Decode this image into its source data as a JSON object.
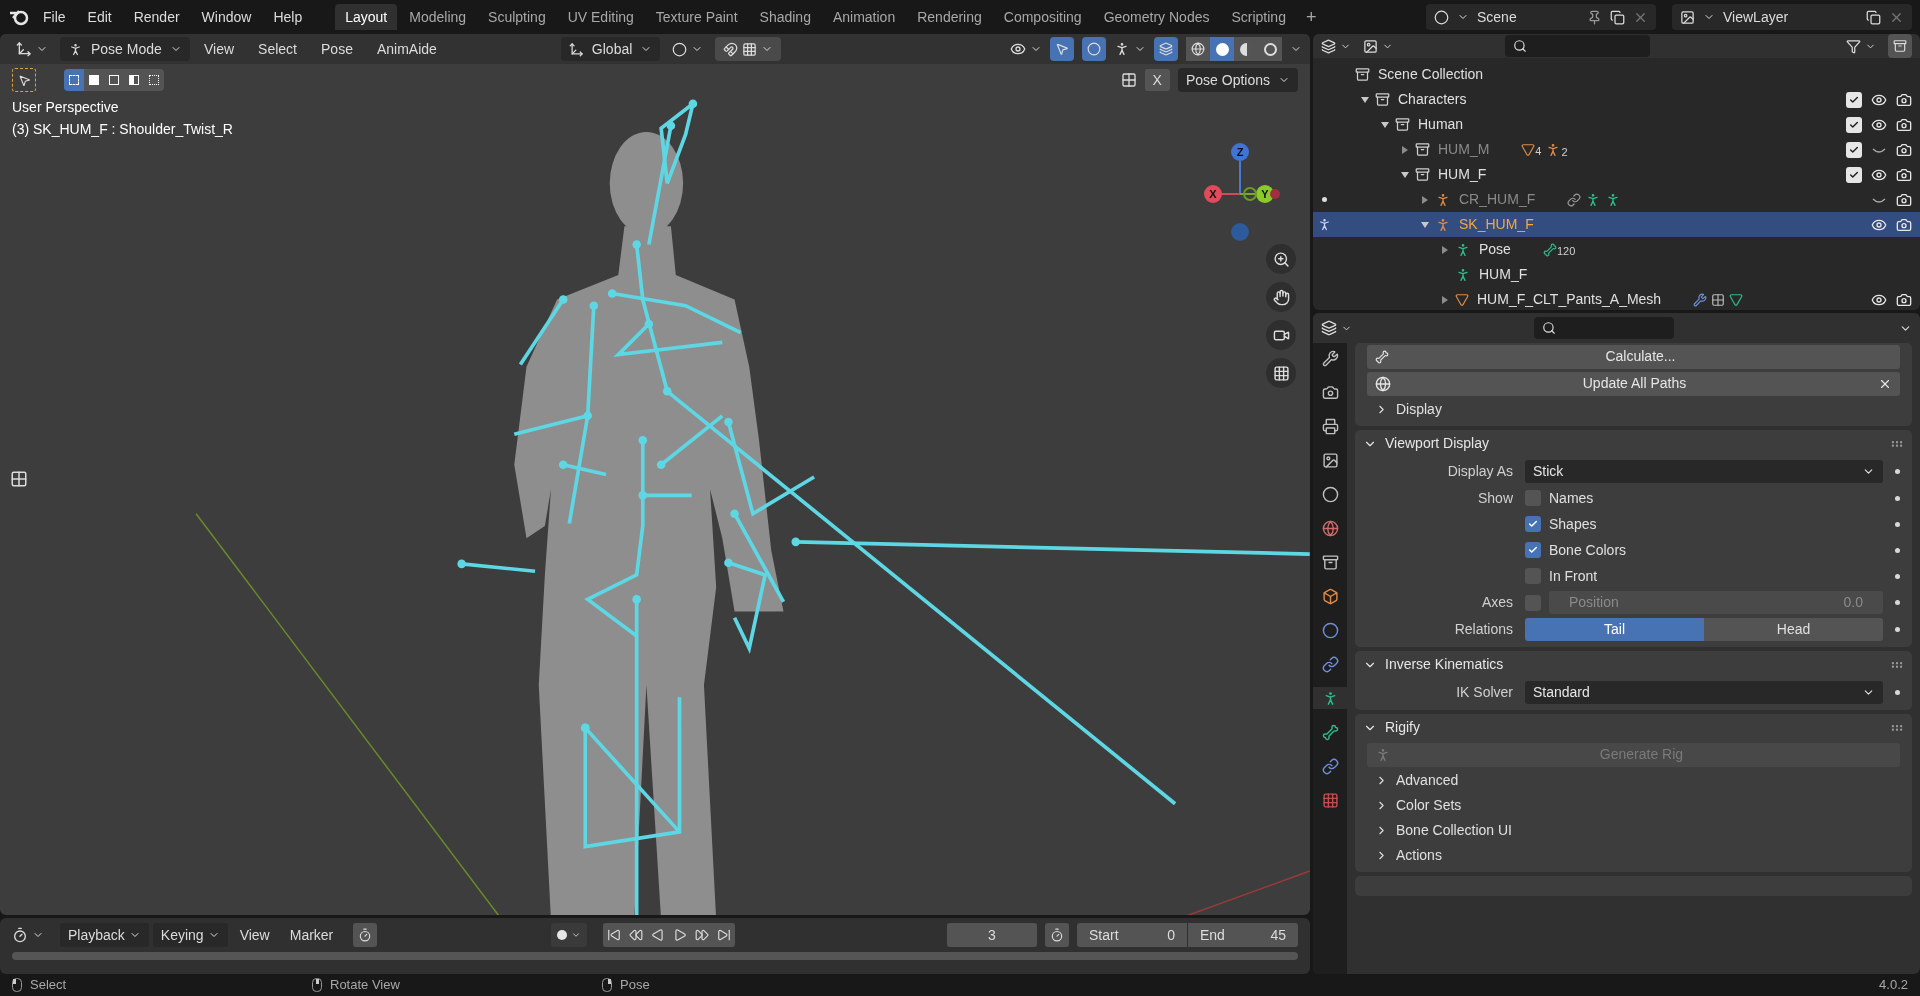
{
  "menu": [
    "File",
    "Edit",
    "Render",
    "Window",
    "Help"
  ],
  "workspaces": [
    {
      "label": "Layout",
      "selected": true
    },
    {
      "label": "Modeling",
      "selected": false
    },
    {
      "label": "Sculpting",
      "selected": false
    },
    {
      "label": "UV Editing",
      "selected": false
    },
    {
      "label": "Texture Paint",
      "selected": false
    },
    {
      "label": "Shading",
      "selected": false
    },
    {
      "label": "Animation",
      "selected": false
    },
    {
      "label": "Rendering",
      "selected": false
    },
    {
      "label": "Compositing",
      "selected": false
    },
    {
      "label": "Geometry Nodes",
      "selected": false
    },
    {
      "label": "Scripting",
      "selected": false
    }
  ],
  "add_workspace": "+",
  "scene": "Scene",
  "view_layer": "ViewLayer",
  "viewport": {
    "mode": "Pose Mode",
    "menus": [
      "View",
      "Select",
      "Pose",
      "AnimAide"
    ],
    "orientation": "Global",
    "shading": [
      {
        "kind": "wireframe",
        "selected": false
      },
      {
        "kind": "solid",
        "selected": true
      },
      {
        "kind": "material",
        "selected": false
      },
      {
        "kind": "rendered",
        "selected": false
      }
    ],
    "select_modes": [
      {
        "kind": "set",
        "selected": true
      },
      {
        "kind": "extend",
        "selected": false
      },
      {
        "kind": "subtract",
        "selected": false
      },
      {
        "kind": "invert",
        "selected": false
      },
      {
        "kind": "intersect",
        "selected": false
      }
    ],
    "mirror": "X",
    "pose_options": "Pose Options",
    "overlay": [
      "User Perspective",
      "(3) SK_HUM_F : Shoulder_Twist_R"
    ],
    "gizmo": {
      "x": "X",
      "y": "Y",
      "z": "Z"
    }
  },
  "outliner": {
    "tree": [
      {
        "name": "Scene Collection",
        "kind": "collection",
        "children": [
          {
            "name": "Characters",
            "kind": "collection",
            "expanded": true,
            "checked": true,
            "visible": true,
            "children": [
              {
                "name": "Human",
                "kind": "collection",
                "expanded": true,
                "checked": true,
                "visible": true,
                "children": [
                  {
                    "name": "HUM_M",
                    "kind": "collection",
                    "expanded": false,
                    "checked": true,
                    "visible": false,
                    "badges": [
                      {
                        "kind": "mesh",
                        "count": "4"
                      },
                      {
                        "kind": "armature",
                        "count": "2"
                      }
                    ]
                  },
                  {
                    "name": "HUM_F",
                    "kind": "collection",
                    "expanded": true,
                    "checked": true,
                    "visible": true,
                    "children": [
                      {
                        "name": "CR_HUM_F",
                        "kind": "armature",
                        "expanded": false,
                        "visible": false,
                        "mode_dot": true,
                        "badges": [
                          {
                            "kind": "constraint"
                          },
                          {
                            "kind": "pose"
                          },
                          {
                            "kind": "armature_data"
                          }
                        ]
                      },
                      {
                        "name": "SK_HUM_F",
                        "kind": "armature",
                        "expanded": true,
                        "visible": true,
                        "selected": true,
                        "pose_mode": true,
                        "children": [
                          {
                            "name": "Pose",
                            "kind": "pose",
                            "expanded": false,
                            "badges": [
                              {
                                "kind": "bone",
                                "count": "120"
                              }
                            ]
                          },
                          {
                            "name": "HUM_F",
                            "kind": "armature_data"
                          },
                          {
                            "name": "HUM_F_CLT_Pants_A_Mesh",
                            "kind": "mesh",
                            "expanded": false,
                            "visible": true,
                            "badges": [
                              {
                                "kind": "modifier"
                              },
                              {
                                "kind": "grid"
                              },
                              {
                                "kind": "vertex_group"
                              }
                            ]
                          }
                        ]
                      }
                    ]
                  }
                ]
              }
            ]
          }
        ]
      }
    ]
  },
  "properties": {
    "tabs": [
      {
        "kind": "tool",
        "selected": false
      },
      {
        "kind": "render",
        "selected": false
      },
      {
        "kind": "output",
        "selected": false
      },
      {
        "kind": "view_layer",
        "selected": false
      },
      {
        "kind": "scene",
        "selected": false
      },
      {
        "kind": "world",
        "selected": false
      },
      {
        "kind": "collection",
        "selected": false
      },
      {
        "kind": "object",
        "selected": false
      },
      {
        "kind": "physics",
        "selected": false
      },
      {
        "kind": "constraint",
        "selected": false
      },
      {
        "kind": "data",
        "selected": true
      },
      {
        "kind": "bone",
        "selected": false
      },
      {
        "kind": "bone_constraint",
        "selected": false
      },
      {
        "kind": "texture",
        "selected": false
      }
    ],
    "panels": [
      {
        "rows": [
          {
            "kind": "button",
            "label": "Calculate..."
          },
          {
            "kind": "button",
            "label": "Update All Paths",
            "closable": true
          },
          {
            "kind": "subpanel",
            "label": "Display",
            "expanded": false
          }
        ]
      },
      {
        "title": "Viewport Display",
        "expanded": true,
        "rows": [
          {
            "kind": "dropdown",
            "label": "Display As",
            "value": "Stick"
          },
          {
            "kind": "checkbox",
            "label": "Show",
            "text": "Names",
            "checked": false
          },
          {
            "kind": "checkbox",
            "text": "Shapes",
            "checked": true
          },
          {
            "kind": "checkbox",
            "text": "Bone Colors",
            "checked": true
          },
          {
            "kind": "checkbox",
            "text": "In Front",
            "checked": false
          },
          {
            "kind": "checkbox_field",
            "label": "Axes",
            "checked": false,
            "field": "Position",
            "value": "0.0",
            "disabled": true
          },
          {
            "kind": "segmented",
            "label": "Relations",
            "options": [
              {
                "label": "Tail",
                "selected": true
              },
              {
                "label": "Head",
                "selected": false
              }
            ]
          }
        ]
      },
      {
        "title": "Inverse Kinematics",
        "expanded": true,
        "rows": [
          {
            "kind": "dropdown",
            "label": "IK Solver",
            "value": "Standard"
          }
        ]
      },
      {
        "title": "Rigify",
        "expanded": true,
        "rows": [
          {
            "kind": "button",
            "label": "Generate Rig",
            "disabled": true
          },
          {
            "kind": "subpanel",
            "label": "Advanced",
            "expanded": false
          },
          {
            "kind": "subpanel",
            "label": "Color Sets",
            "expanded": false
          },
          {
            "kind": "subpanel",
            "label": "Bone Collection UI",
            "expanded": false
          },
          {
            "kind": "subpanel",
            "label": "Actions",
            "expanded": false
          }
        ]
      }
    ]
  },
  "timeline": {
    "menus": [
      "Playback",
      "Keying",
      "View",
      "Marker"
    ],
    "current_frame": "3",
    "start_label": "Start",
    "start": "0",
    "end_label": "End",
    "end": "45"
  },
  "status_bar": {
    "hints": [
      {
        "kind": "left",
        "label": "Select"
      },
      {
        "kind": "middle",
        "label": "Rotate View"
      },
      {
        "kind": "right",
        "label": "Pose"
      }
    ],
    "version": "4.0.2"
  }
}
